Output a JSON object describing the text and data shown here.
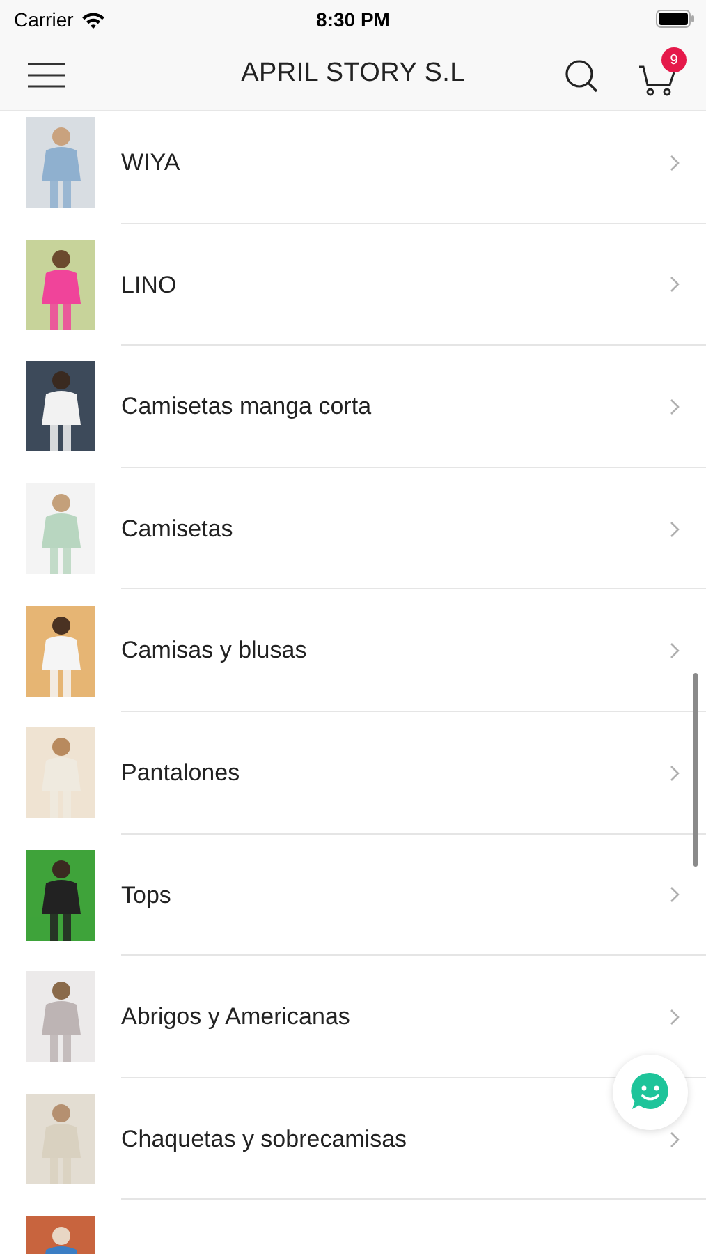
{
  "status_bar": {
    "carrier": "Carrier",
    "time": "8:30 PM"
  },
  "nav_bar": {
    "title": "APRIL STORY S.L",
    "cart_count": "9"
  },
  "categories": [
    {
      "kind": "category",
      "label": "WIYA"
    },
    {
      "kind": "category",
      "label": "LINO"
    },
    {
      "kind": "category",
      "label": "Camisetas manga corta"
    },
    {
      "kind": "category",
      "label": "Camisetas"
    },
    {
      "kind": "category",
      "label": "Camisas y blusas"
    },
    {
      "kind": "category",
      "label": "Pantalones"
    },
    {
      "kind": "category",
      "label": "Tops"
    },
    {
      "kind": "category",
      "label": "Abrigos y Americanas"
    },
    {
      "kind": "category",
      "label": "Chaquetas y sobrecamisas"
    },
    {
      "kind": "picture"
    }
  ]
}
